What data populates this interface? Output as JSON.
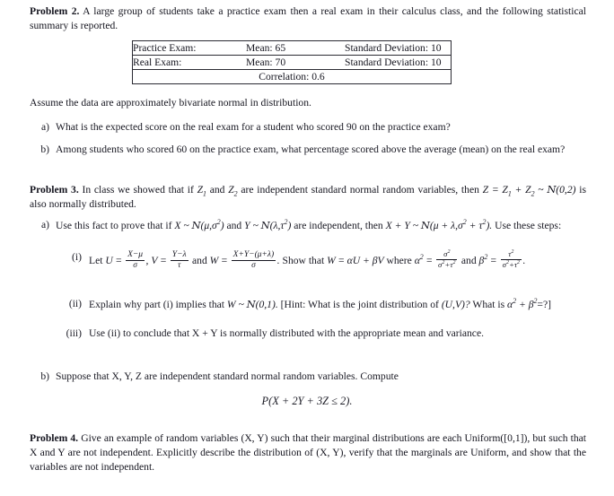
{
  "document": {
    "problem2": {
      "heading": "Problem 2.",
      "intro": "A large group of students take a practice exam then a real exam in their calculus class, and the following statistical summary is reported.",
      "table": {
        "rows": [
          {
            "label": "Practice Exam:",
            "mean": "Mean: 65",
            "sd": "Standard Deviation: 10"
          },
          {
            "label": "Real Exam:",
            "mean": "Mean: 70",
            "sd": "Standard Deviation: 10"
          }
        ],
        "correlation": "Correlation: 0.6"
      },
      "assume_line": "Assume the data are approximately bivariate normal in distribution.",
      "items": [
        {
          "marker": "a)",
          "text": "What is the expected score on the real exam for a student who scored 90 on the practice exam?"
        },
        {
          "marker": "b)",
          "text": "Among students who scored 60 on the practice exam, what percentage scored above the average (mean) on the real exam?"
        }
      ]
    },
    "problem3": {
      "heading": "Problem 3.",
      "intro_part1": "In class we showed that if",
      "intro_Z1": "Z",
      "intro_Z1_sub": "1",
      "intro_and": "and",
      "intro_Z2": "Z",
      "intro_Z2_sub": "2",
      "intro_part2": "are independent standard normal random variables, then",
      "intro_eq": "Z = Z₁ + Z₂ ~ N(0,2)",
      "intro_part3": "is also normally distributed.",
      "item_a": {
        "marker": "a)",
        "text_lead": "Use this fact to prove that if",
        "text_mid": "are independent, then",
        "text_tail": "Use these steps:"
      },
      "subitems": [
        {
          "marker": "(i)",
          "lead": "Let",
          "mid": "and",
          "show": "Show that",
          "where": "where",
          "alpha_label": "α",
          "beta_label": "β",
          "and_word": "and"
        },
        {
          "marker": "(ii)",
          "text_a": "Explain why part (i) implies that",
          "text_b": "[Hint: What is the joint distribution of",
          "text_c": "What is",
          "text_d": "=?]"
        },
        {
          "marker": "(iii)",
          "text": "Use (ii) to conclude that X + Y is normally distributed with the appropriate mean and variance."
        }
      ],
      "item_b": {
        "marker": "b)",
        "text": "Suppose that X, Y, Z are independent standard normal random variables. Compute",
        "display_equation": "P(X + 2Y + 3Z ≤ 2)."
      }
    },
    "problem4": {
      "heading": "Problem 4.",
      "text": "Give an example of random variables (X, Y) such that their marginal distributions are each Uniform([0,1]), but such that X and Y are not independent. Explicitly describe the distribution of (X, Y), verify that the marginals are Uniform, and show that the variables are not independent."
    }
  },
  "style": {
    "text_color": "#15151f",
    "rule_color": "#2b2b33",
    "page_background": "#ffffff"
  }
}
